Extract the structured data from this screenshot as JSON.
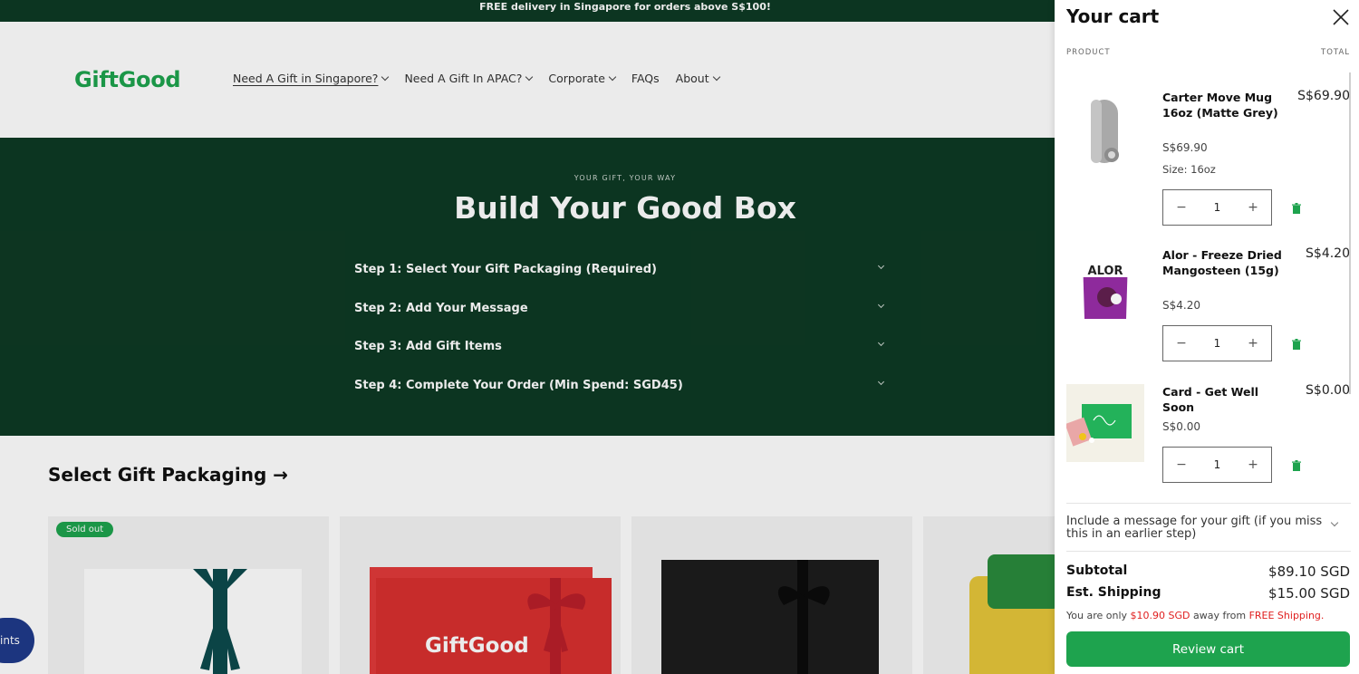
{
  "announcement": "FREE delivery in Singapore for orders above S$100!",
  "brand": "GiftGood",
  "nav": [
    {
      "label": "Need A Gift in Singapore?",
      "dropdown": true,
      "active": true
    },
    {
      "label": "Need A Gift In APAC?",
      "dropdown": true
    },
    {
      "label": "Corporate",
      "dropdown": true
    },
    {
      "label": "FAQs",
      "dropdown": false
    },
    {
      "label": "About",
      "dropdown": true
    }
  ],
  "hero": {
    "eyebrow": "YOUR GIFT, YOUR WAY",
    "title": "Build Your Good Box",
    "steps": [
      "Step 1: Select Your Gift Packaging (Required)",
      "Step 2: Add Your Message",
      "Step 3: Add Gift Items",
      "Step 4: Complete Your Order (Min Spend: SGD45)"
    ]
  },
  "packaging": {
    "section_title": "Select Gift Packaging →",
    "sold_out_badge": "Sold out",
    "box_logo": "GiftGood"
  },
  "points_widget": "ints",
  "cart": {
    "title": "Your cart",
    "col_product": "PRODUCT",
    "col_total": "TOTAL",
    "items": [
      {
        "name": "Carter Move Mug 16oz (Matte Grey)",
        "total": "S$69.90",
        "price": "S$69.90",
        "size": "Size: 16oz",
        "qty": "1",
        "thumb": "mug-image"
      },
      {
        "name": "Alor - Freeze Dried Mangosteen (15g)",
        "total": "S$4.20",
        "price": "S$4.20",
        "qty": "1",
        "thumb": "alor-pack-image",
        "thumb_text": "ALOR"
      },
      {
        "name": "Card - Get Well Soon",
        "total": "S$0.00",
        "price": "S$0.00",
        "qty": "1",
        "thumb": "card-image"
      }
    ],
    "gift_message": "Include a message for your gift (if you miss this in an earlier step)",
    "subtotal_label": "Subtotal",
    "subtotal_value": "$89.10 SGD",
    "shipping_label": "Est. Shipping",
    "shipping_value": "$15.00 SGD",
    "ship_note_prefix": "You are only ",
    "ship_note_amount": "$10.90 SGD",
    "ship_note_mid": " away from ",
    "ship_note_free": "FREE Shipping.",
    "review_button": "Review cart"
  },
  "colors": {
    "brand_green": "#1ea34e",
    "dark_green": "#0e3a24",
    "alert_red": "#e02020"
  }
}
